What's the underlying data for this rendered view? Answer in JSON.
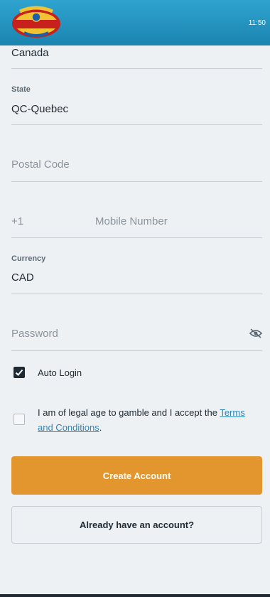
{
  "header": {
    "logo_alt": "Lucky Emperor Casino",
    "clock": "11:50",
    "colors": {
      "bar": "#1b84b0"
    }
  },
  "form": {
    "country": {
      "value": "Canada"
    },
    "state": {
      "label": "State",
      "value": "QC-Quebec"
    },
    "postal_code": {
      "placeholder": "Postal Code"
    },
    "mobile": {
      "prefix": "+1",
      "placeholder": "Mobile Number"
    },
    "currency": {
      "label": "Currency",
      "value": "CAD"
    },
    "password": {
      "placeholder": "Password",
      "icon": "eye-off-icon"
    },
    "auto_login": {
      "label": "Auto Login",
      "checked": true
    },
    "terms": {
      "checked": false,
      "text": "I am of legal age to gamble and I accept the ",
      "link": "Terms and Conditions",
      "suffix": "."
    }
  },
  "buttons": {
    "create": "Create Account",
    "login": "Already have an account?"
  },
  "colors": {
    "accent": "#e3952e",
    "link": "#2f86b7"
  }
}
